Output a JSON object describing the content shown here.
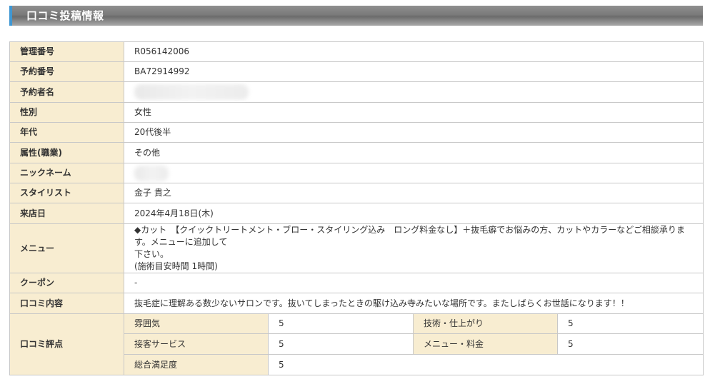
{
  "header": {
    "title": "口コミ投稿情報"
  },
  "rows": {
    "kanri_bango": {
      "label": "管理番号",
      "value": "R056142006"
    },
    "yoyaku_bango": {
      "label": "予約番号",
      "value": "BA72914992"
    },
    "yoyakusha_mei": {
      "label": "予約者名",
      "value": ""
    },
    "seibetsu": {
      "label": "性別",
      "value": "女性"
    },
    "nendai": {
      "label": "年代",
      "value": "20代後半"
    },
    "zokusei": {
      "label": "属性(職業)",
      "value": "その他"
    },
    "nickname": {
      "label": "ニックネーム",
      "value": ""
    },
    "stylist": {
      "label": "スタイリスト",
      "value": "金子 貴之"
    },
    "raiten_bi": {
      "label": "来店日",
      "value": "2024年4月18日(木)"
    },
    "menu": {
      "label": "メニュー",
      "line1": "◆カット　【クイックトリートメント・ブロー・スタイリング込み　ロング料金なし】＋抜毛癖でお悩みの方、カットやカラーなどご相談承ります。メニューに追加して",
      "line2": "下さい。",
      "line3": "(施術目安時間 1時間)"
    },
    "coupon": {
      "label": "クーポン",
      "value": "-"
    },
    "kuchikomi_naiyo": {
      "label": "口コミ内容",
      "value": "抜毛症に理解ある数少ないサロンです。抜いてしまったときの駆け込み寺みたいな場所です。またしばらくお世話になります！！"
    },
    "kuchikomi_hyoten": {
      "label": "口コミ評点",
      "fun_iki": {
        "label": "雰囲気",
        "value": "5"
      },
      "gijutsu": {
        "label": "技術・仕上がり",
        "value": "5"
      },
      "sekkyaku": {
        "label": "接客サービス",
        "value": "5"
      },
      "menu_ryokin": {
        "label": "メニュー・料金",
        "value": "5"
      },
      "sogo": {
        "label": "総合満足度",
        "value": "5"
      }
    }
  }
}
